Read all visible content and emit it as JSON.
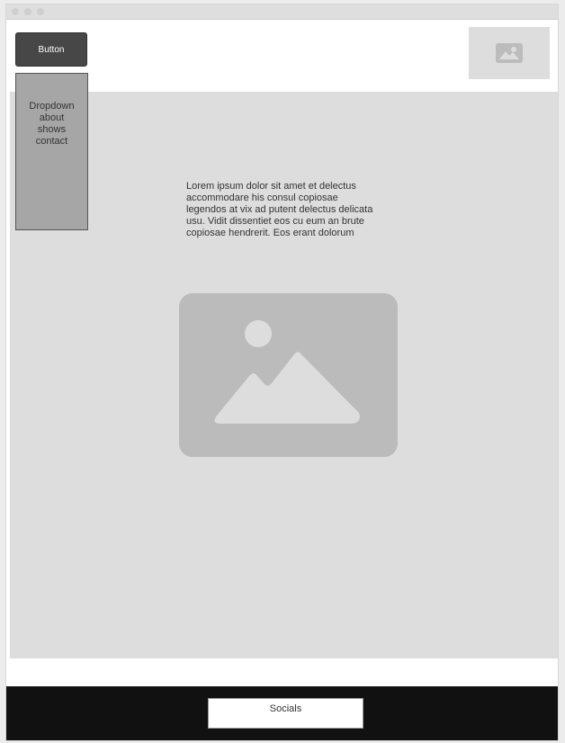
{
  "window": {
    "controls": [
      "window-dot",
      "window-dot",
      "window-dot"
    ]
  },
  "header": {
    "button_label": "Button",
    "logo_icon": "image-placeholder-icon"
  },
  "dropdown": {
    "items": [
      "Dropdown",
      "about",
      "shows",
      "contact"
    ]
  },
  "main": {
    "body_text": "Lorem ipsum dolor sit amet et delectus accommodare his consul copiosae legendos at vix ad putent delectus delicata usu. Vidit dissentiet eos cu eum an brute copiosae hendrerit. Eos erant dolorum",
    "image_icon": "image-placeholder-icon"
  },
  "footer": {
    "socials_label": "Socials"
  },
  "colors": {
    "content_bg": "#dddddd",
    "placeholder": "#bbbbbb",
    "button": "#474747",
    "dropdown": "#a6a6a6",
    "footer": "#111111"
  }
}
